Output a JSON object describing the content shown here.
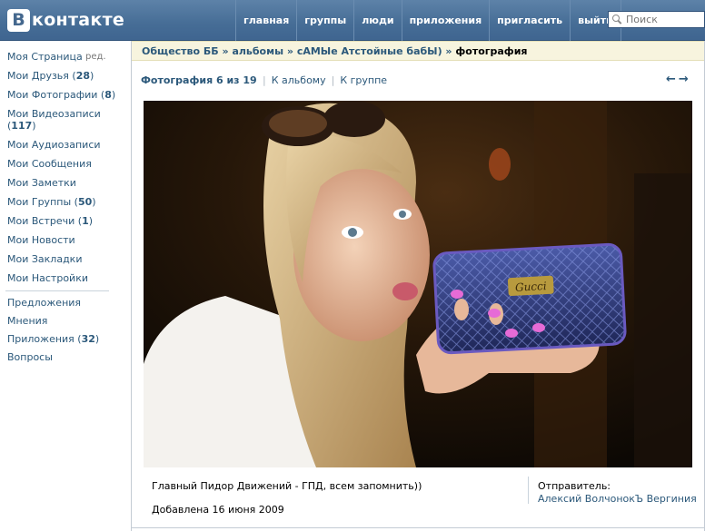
{
  "header": {
    "logo_letter": "В",
    "logo_text": "контакте",
    "nav": [
      "главная",
      "группы",
      "люди",
      "приложения",
      "пригласить",
      "выйти"
    ],
    "search_placeholder": "Поиск",
    "bg_color": "#466d96"
  },
  "leftmenu": {
    "my_page": "Моя Страница",
    "edit": "ред.",
    "items": [
      {
        "label": "Мои Друзья (",
        "count": "28",
        "close": ")"
      },
      {
        "label": "Мои Фотографии (",
        "count": "8",
        "close": ")"
      },
      {
        "label": "Мои Видеозаписи (",
        "count": "117",
        "close": ")"
      },
      {
        "label": "Мои Аудиозаписи"
      },
      {
        "label": "Мои Сообщения"
      },
      {
        "label": "Мои Заметки"
      },
      {
        "label": "Мои Группы (",
        "count": "50",
        "close": ")"
      },
      {
        "label": "Мои Встречи (",
        "count": "1",
        "close": ")"
      },
      {
        "label": "Мои Новости"
      },
      {
        "label": "Мои Закладки"
      },
      {
        "label": "Мои Настройки"
      }
    ],
    "extra": [
      {
        "label": "Предложения"
      },
      {
        "label": "Мнения"
      },
      {
        "label": "Приложения (",
        "count": "32",
        "close": ")"
      },
      {
        "label": "Вопросы"
      }
    ],
    "link_color": "#2b587a"
  },
  "breadcrumb": {
    "parts": [
      "Общество ББ",
      "альбомы",
      "сАМЫе Атстойные бабЫ)"
    ],
    "separator": " » ",
    "current": "фотография"
  },
  "photo_nav": {
    "counter": "Фотография 6 из 19",
    "to_album": "К альбому",
    "to_group": "К группе",
    "divider": "|",
    "arrows": "←→"
  },
  "photo": {
    "brand_text": "Gucci"
  },
  "info": {
    "caption": "Главный Пидор Движений - ГПД, всем запомнить))",
    "added": "Добавлена 16 июня 2009",
    "sender_label": "Отправитель:",
    "sender_name": "Алексий ВолчонокЪ Вергиния"
  }
}
